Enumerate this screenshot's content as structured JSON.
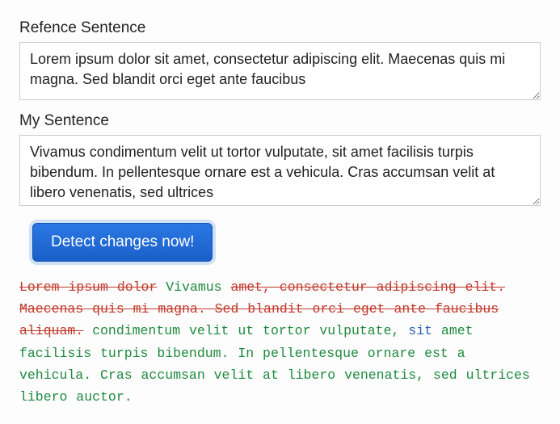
{
  "labels": {
    "reference": "Refence Sentence",
    "mine": "My Sentence"
  },
  "inputs": {
    "reference": "Lorem ipsum dolor sit amet, consectetur adipiscing elit. Maecenas quis mi magna. Sed blandit orci eget ante faucibus",
    "mine": "Vivamus condimentum velit ut tortor vulputate, sit amet facilisis turpis bibendum. In pellentesque ornare est a vehicula. Cras accumsan velit at libero venenatis, sed ultrices"
  },
  "button": {
    "label": "Detect changes now!"
  },
  "diff": {
    "del1": "Lorem ipsum dolor",
    "ins1": "Vivamus",
    "del2": "amet, consectetur adipiscing elit. Maecenas quis mi magna. Sed blandit orci eget ante faucibus aliquam.",
    "ins2": "condimentum velit ut tortor vulputate,",
    "keep1": "sit",
    "ins3": "amet facilisis turpis bibendum. In pellentesque ornare est a vehicula. Cras accumsan velit at libero venenatis, sed ultrices libero auctor."
  }
}
